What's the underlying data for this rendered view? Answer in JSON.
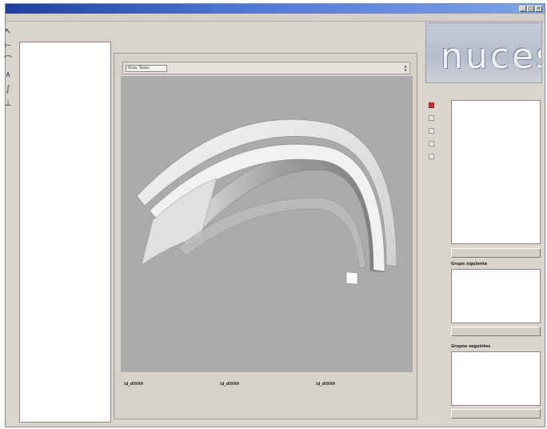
{
  "menu": [],
  "main_tabs": [],
  "tree": {
    "rows": []
  },
  "center_tabs": [],
  "view": {
    "selector": "Vista: Todas"
  },
  "coords": {
    "x": "id_dt999",
    "y": "id_dt999",
    "z": "id_dt999"
  },
  "right": {
    "logo_text": "nuces",
    "tabs": [],
    "section1_label": "Grupo siguiente",
    "section2_label": "Grupos seguintes"
  },
  "colors": {
    "title_bar": "#1c3fa0",
    "viewport": "#ababab",
    "tree_icon": "#2e9a3a"
  }
}
